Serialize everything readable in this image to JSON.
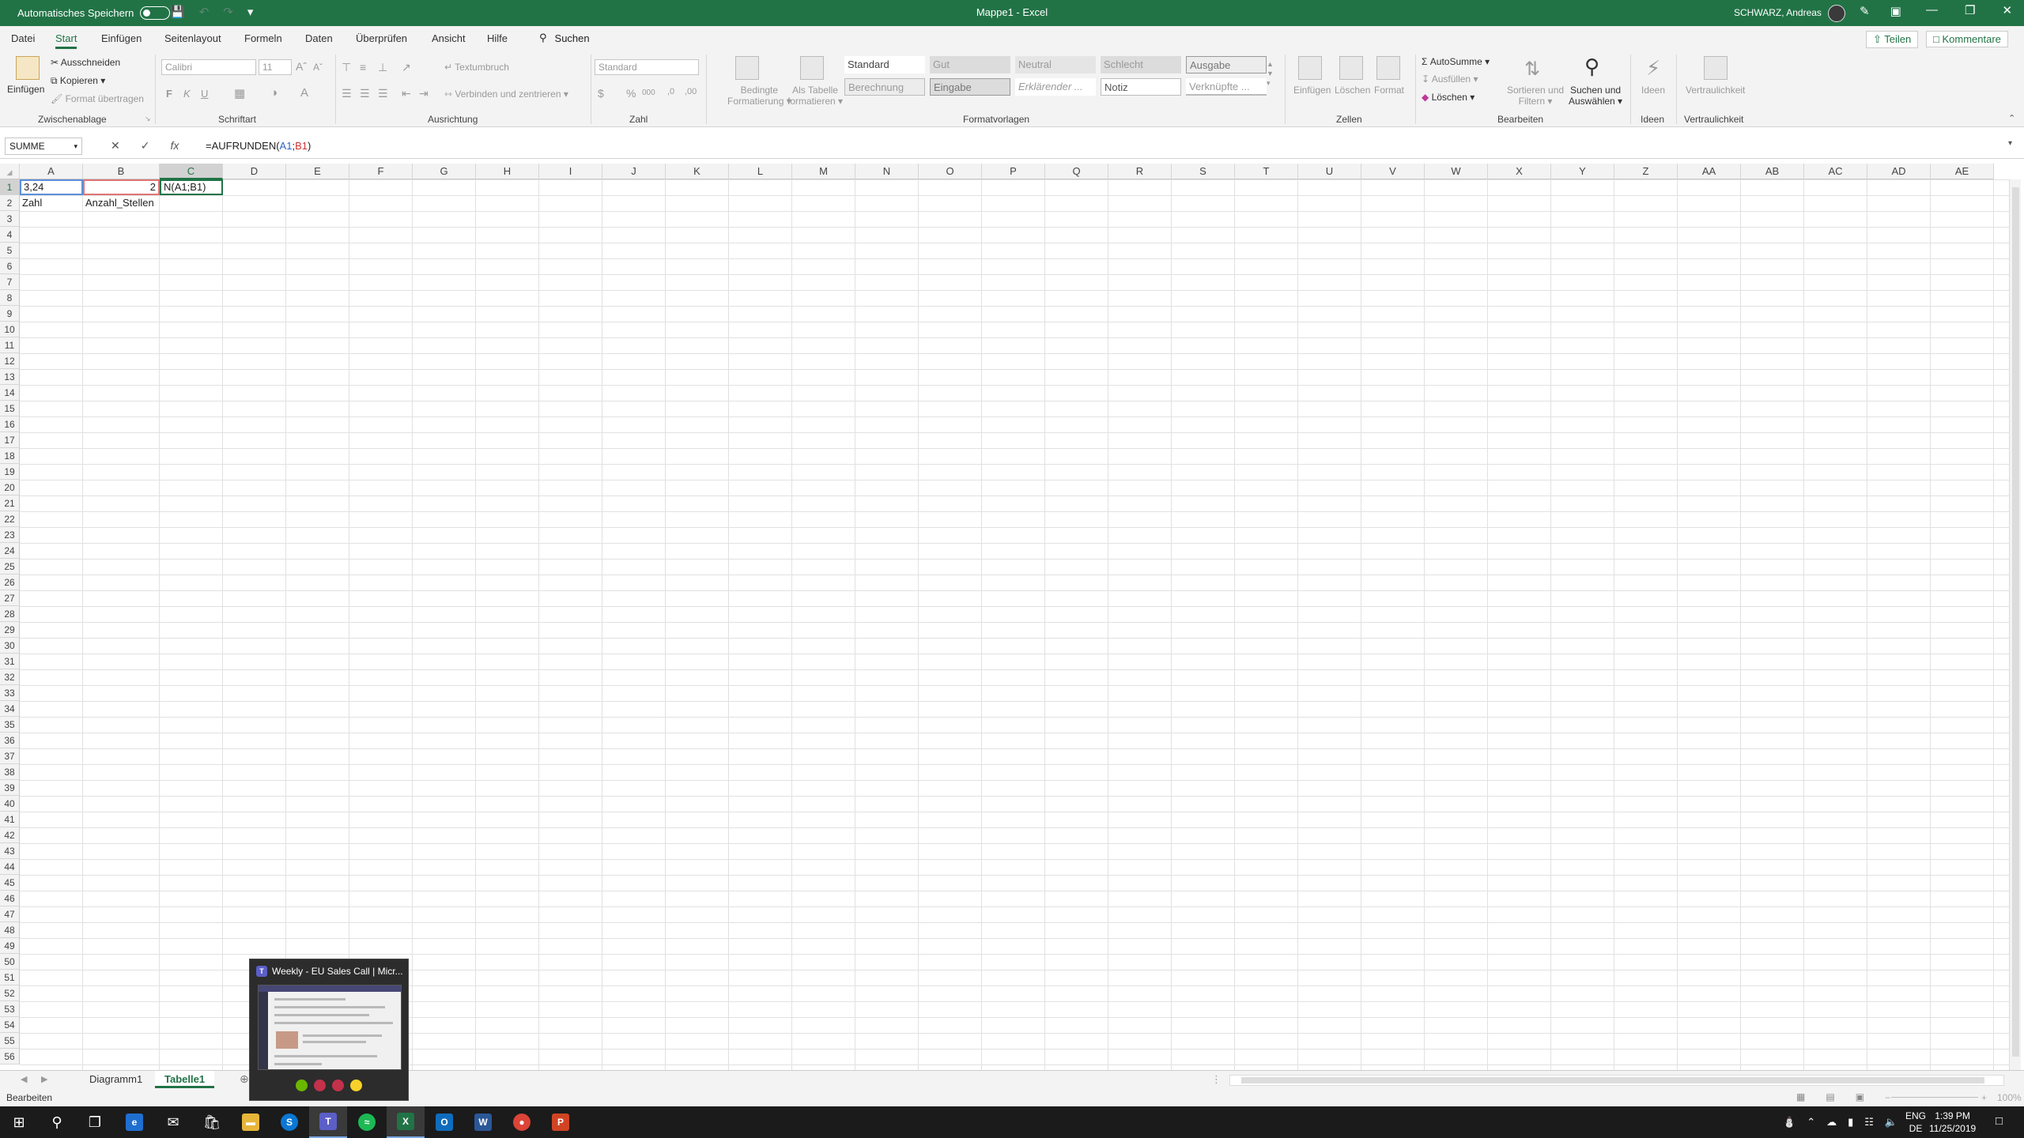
{
  "titlebar": {
    "autosave_label": "Automatisches Speichern",
    "document_title": "Mappe1 - Excel",
    "user_name": "SCHWARZ, Andreas"
  },
  "tabs": [
    "Datei",
    "Start",
    "Einfügen",
    "Seitenlayout",
    "Formeln",
    "Daten",
    "Überprüfen",
    "Ansicht",
    "Hilfe"
  ],
  "active_tab": "Start",
  "search_label": "Suchen",
  "share_label": "Teilen",
  "comments_label": "Kommentare",
  "ribbon": {
    "clipboard": {
      "paste": "Einfügen",
      "cut": "Ausschneiden",
      "copy": "Kopieren",
      "format_painter": "Format übertragen",
      "label": "Zwischenablage"
    },
    "font": {
      "name": "Calibri",
      "size": "11",
      "bold": "F",
      "italic": "K",
      "underline": "U",
      "label": "Schriftart"
    },
    "alignment": {
      "wrap": "Textumbruch",
      "merge": "Verbinden und zentrieren",
      "label": "Ausrichtung"
    },
    "number": {
      "format": "Standard",
      "label": "Zahl"
    },
    "styles": {
      "conditional_line1": "Bedingte",
      "conditional_line2": "Formatierung",
      "as_table_line1": "Als Tabelle",
      "as_table_line2": "formatieren",
      "cells": [
        "Standard",
        "Gut",
        "Neutral",
        "Schlecht",
        "Ausgabe",
        "Berechnung",
        "Eingabe",
        "Erklärender ...",
        "Notiz",
        "Verknüpfte ..."
      ],
      "label": "Formatvorlagen"
    },
    "cells": {
      "insert": "Einfügen",
      "delete": "Löschen",
      "format": "Format",
      "label": "Zellen"
    },
    "editing": {
      "autosum": "AutoSumme",
      "fill": "Ausfüllen",
      "clear": "Löschen",
      "sort_line1": "Sortieren und",
      "sort_line2": "Filtern",
      "find_line1": "Suchen und",
      "find_line2": "Auswählen",
      "label": "Bearbeiten"
    },
    "ideas": {
      "button": "Ideen",
      "label": "Ideen"
    },
    "sensitivity": {
      "button": "Vertraulichkeit",
      "label": "Vertraulichkeit"
    }
  },
  "formula_bar": {
    "name_box": "SUMME",
    "formula_prefix": "=AUFRUNDEN(",
    "ref1": "A1",
    "sep": ";",
    "ref2": "B1",
    "formula_suffix": ")"
  },
  "columns": [
    "A",
    "B",
    "C",
    "D",
    "E",
    "F",
    "G",
    "H",
    "I",
    "J",
    "K",
    "L",
    "M",
    "N",
    "O",
    "P",
    "Q",
    "R",
    "S",
    "T",
    "U",
    "V",
    "W",
    "X",
    "Y",
    "Z",
    "AA",
    "AB",
    "AC",
    "AD",
    "AE"
  ],
  "row_count": 56,
  "cells": {
    "A1": "3,24",
    "B1": "2",
    "C1": "N(A1;B1)",
    "A2": "Zahl",
    "B2": "Anzahl_Stellen"
  },
  "sheets": [
    "Diagramm1",
    "Tabelle1"
  ],
  "active_sheet": "Tabelle1",
  "status": "Bearbeiten",
  "zoom_label": "100%",
  "preview": {
    "title": "Weekly - EU Sales Call | Micr..."
  },
  "taskbar": {
    "lang_line1": "ENG",
    "lang_line2": "DE",
    "time": "1:39 PM",
    "date": "11/25/2019"
  },
  "colors": {
    "excel_green": "#217346",
    "ref_blue": "#2e64c9",
    "ref_red": "#c33"
  }
}
